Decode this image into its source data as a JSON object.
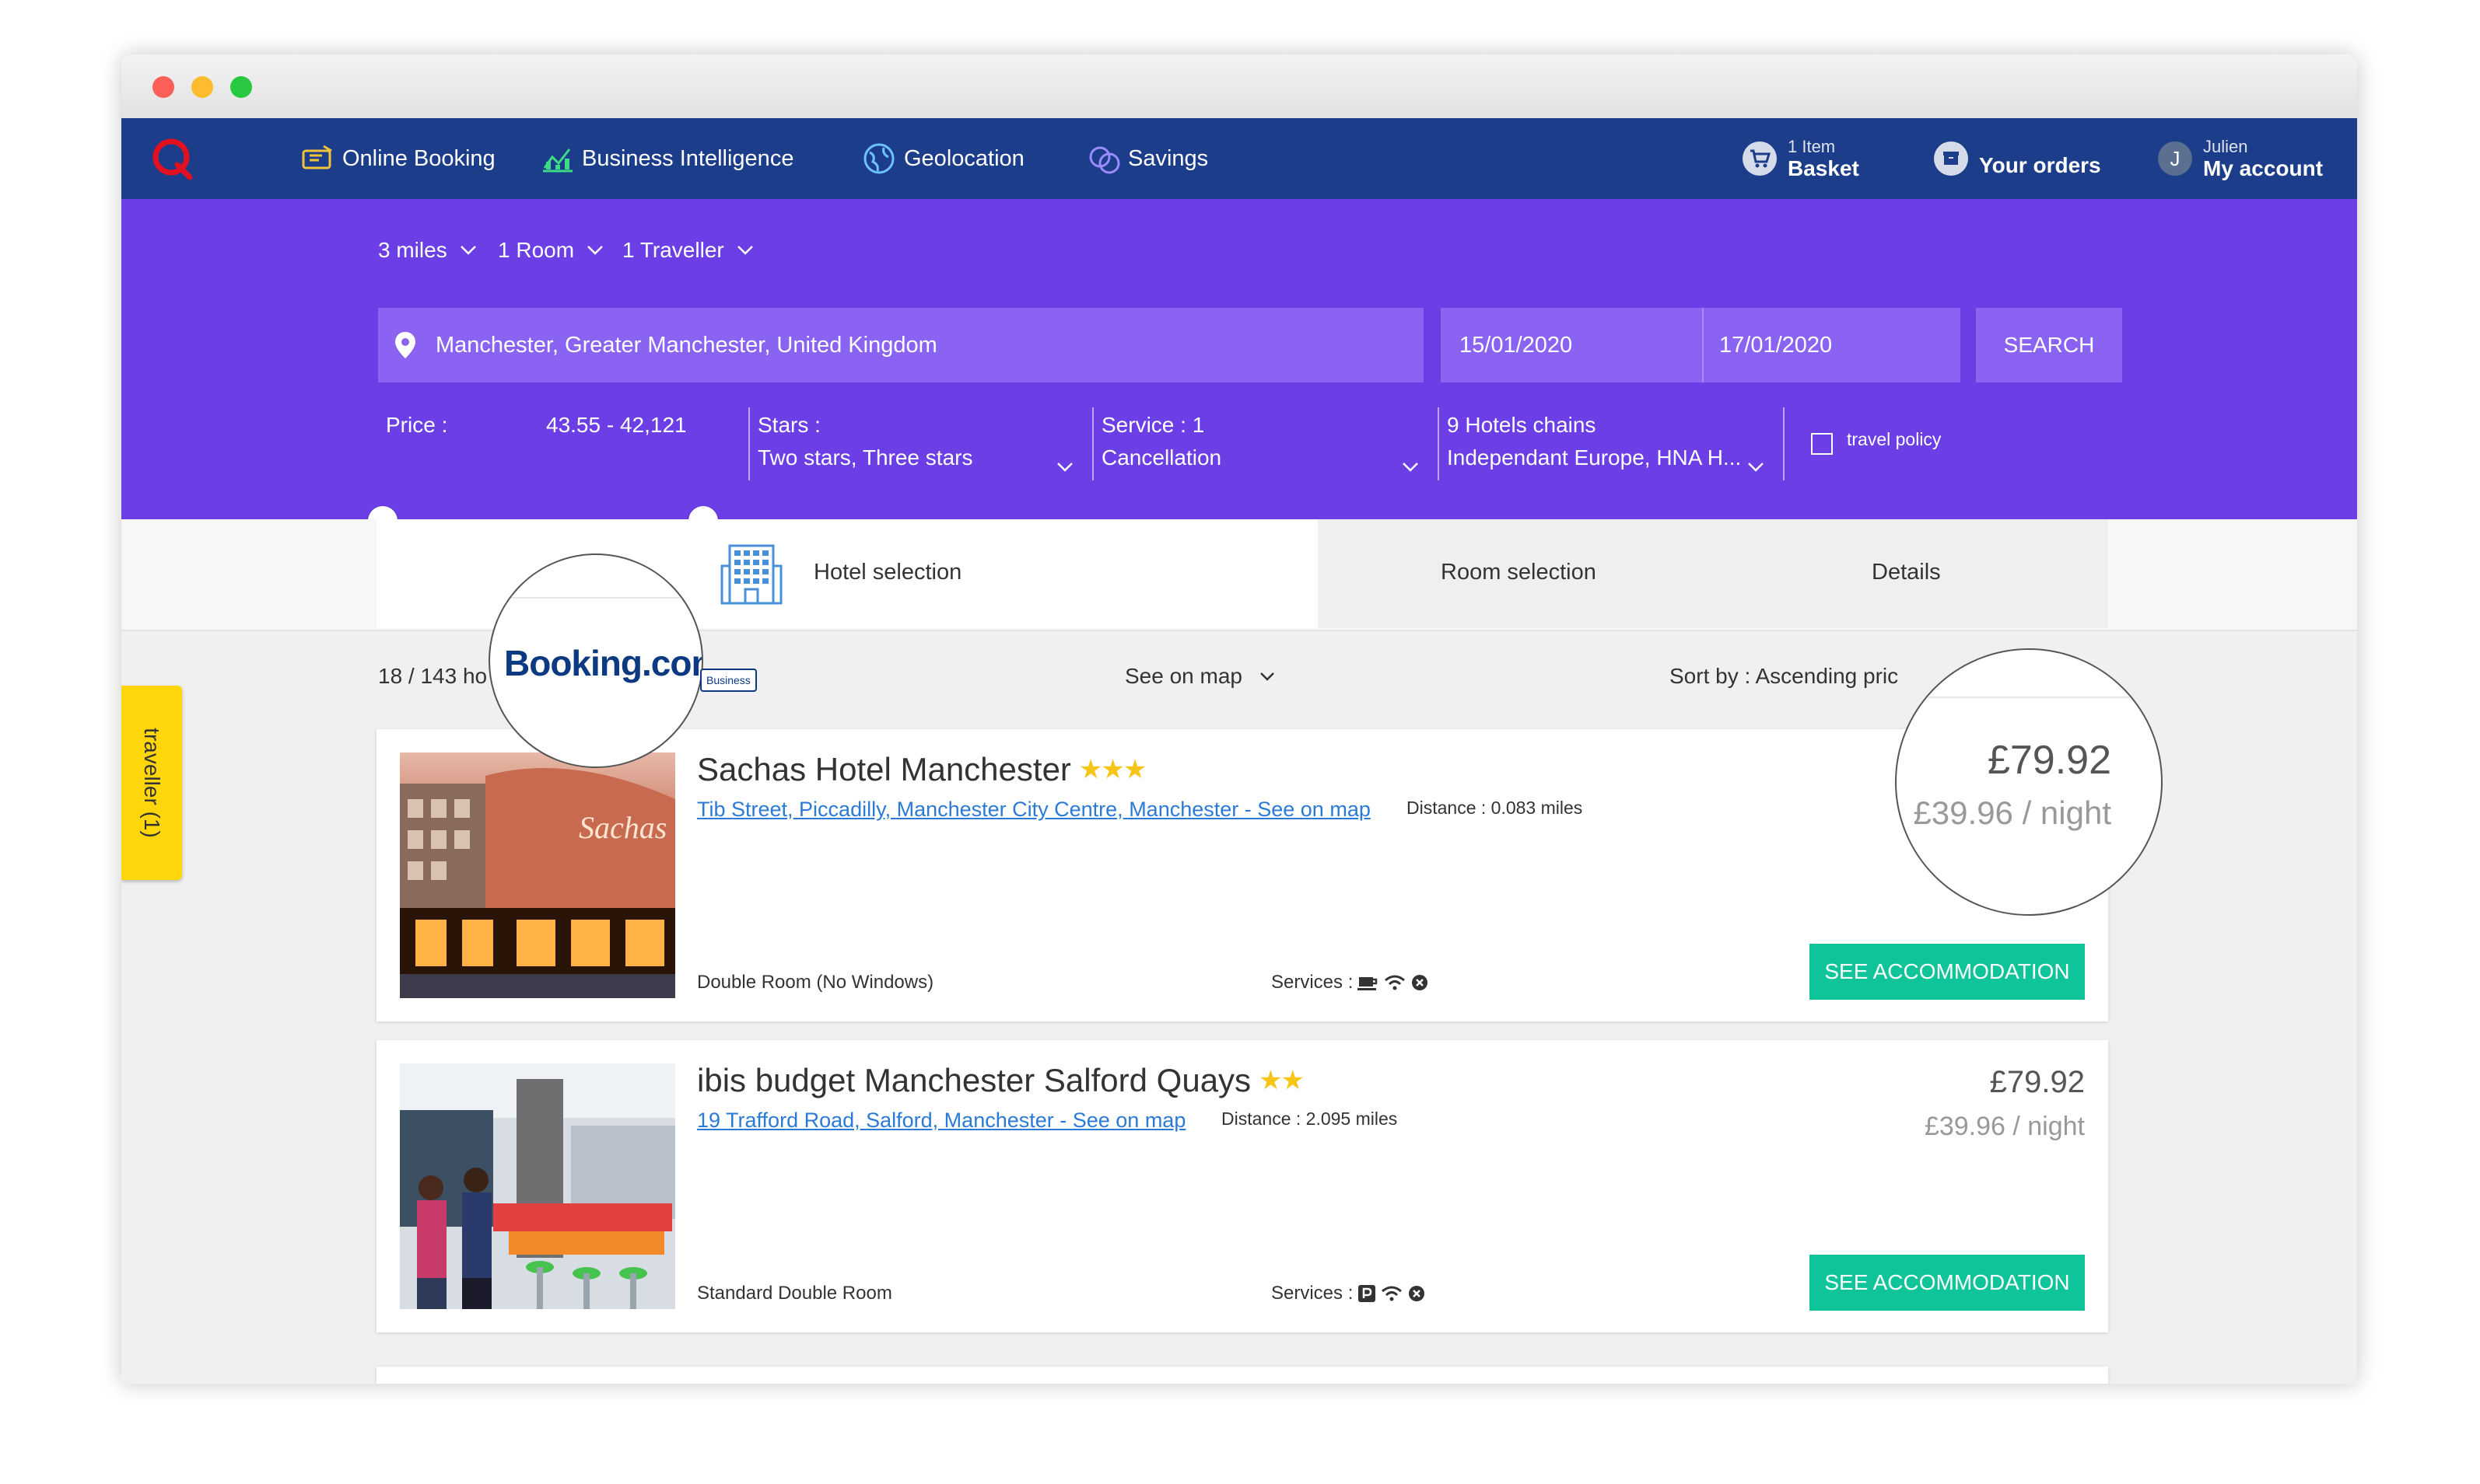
{
  "nav": {
    "online_booking": "Online Booking",
    "business_intelligence": "Business Intelligence",
    "geolocation": "Geolocation",
    "savings": "Savings",
    "basket_count": "1 Item",
    "basket": "Basket",
    "your_orders": "Your orders",
    "user_initial": "J",
    "user_name": "Julien",
    "my_account": "My account"
  },
  "search": {
    "radius": "3 miles",
    "rooms": "1 Room",
    "travellers": "1 Traveller",
    "location": "Manchester, Greater Manchester, United Kingdom",
    "checkin": "15/01/2020",
    "checkout": "17/01/2020",
    "search_button": "SEARCH"
  },
  "filters": {
    "price_label": "Price :",
    "price_range": "43.55 - 42,121",
    "price_range_fraction": [
      0.0,
      1.0
    ],
    "stars_label": "Stars :",
    "stars_value": "Two stars, Three stars",
    "service_label": "Service : 1",
    "service_value": "Cancellation",
    "chains_label": "9 Hotels chains",
    "chains_value": "Independant Europe, HNA H...",
    "travel_policy": "travel policy"
  },
  "steps": {
    "hotel": "Hotel selection",
    "room": "Room selection",
    "details": "Details"
  },
  "results": {
    "count_prefix": "18 / 143 ho",
    "booking_logo": "Booking.com",
    "booking_badge": "Business",
    "see_on_map": "See on map",
    "sort": "Sort by : Ascending pric"
  },
  "hotels": [
    {
      "name": "Sachas Hotel Manchester",
      "stars": "★★★",
      "address": "Tib Street, Piccadilly, Manchester City Centre, Manchester - See on map",
      "distance": "Distance : 0.083 miles",
      "room": "Double Room (No Windows)",
      "services_label": "Services :",
      "price": "£79.92",
      "per_night": "£39.96 / night",
      "button": "SEE ACCOMMODATION",
      "photo_text": "Sachas"
    },
    {
      "name": "ibis budget Manchester Salford Quays",
      "stars": "★★",
      "address": "19 Trafford Road, Salford, Manchester - See on map",
      "distance": "Distance : 2.095 miles",
      "room": "Standard Double Room",
      "services_label": "Services :",
      "price": "£79.92",
      "per_night": "£39.96 / night",
      "button": "SEE ACCOMMODATION"
    }
  ],
  "traveller_tab": "traveller (1)",
  "colors": {
    "nav_bg": "#1c3d8a",
    "search_bg": "#6b3ee6",
    "field_bg": "#8a63f2",
    "button_green": "#10c49a",
    "link_blue": "#2a7ad6",
    "star_yellow": "#f5c518",
    "traveller_yellow": "#ffd60a"
  }
}
